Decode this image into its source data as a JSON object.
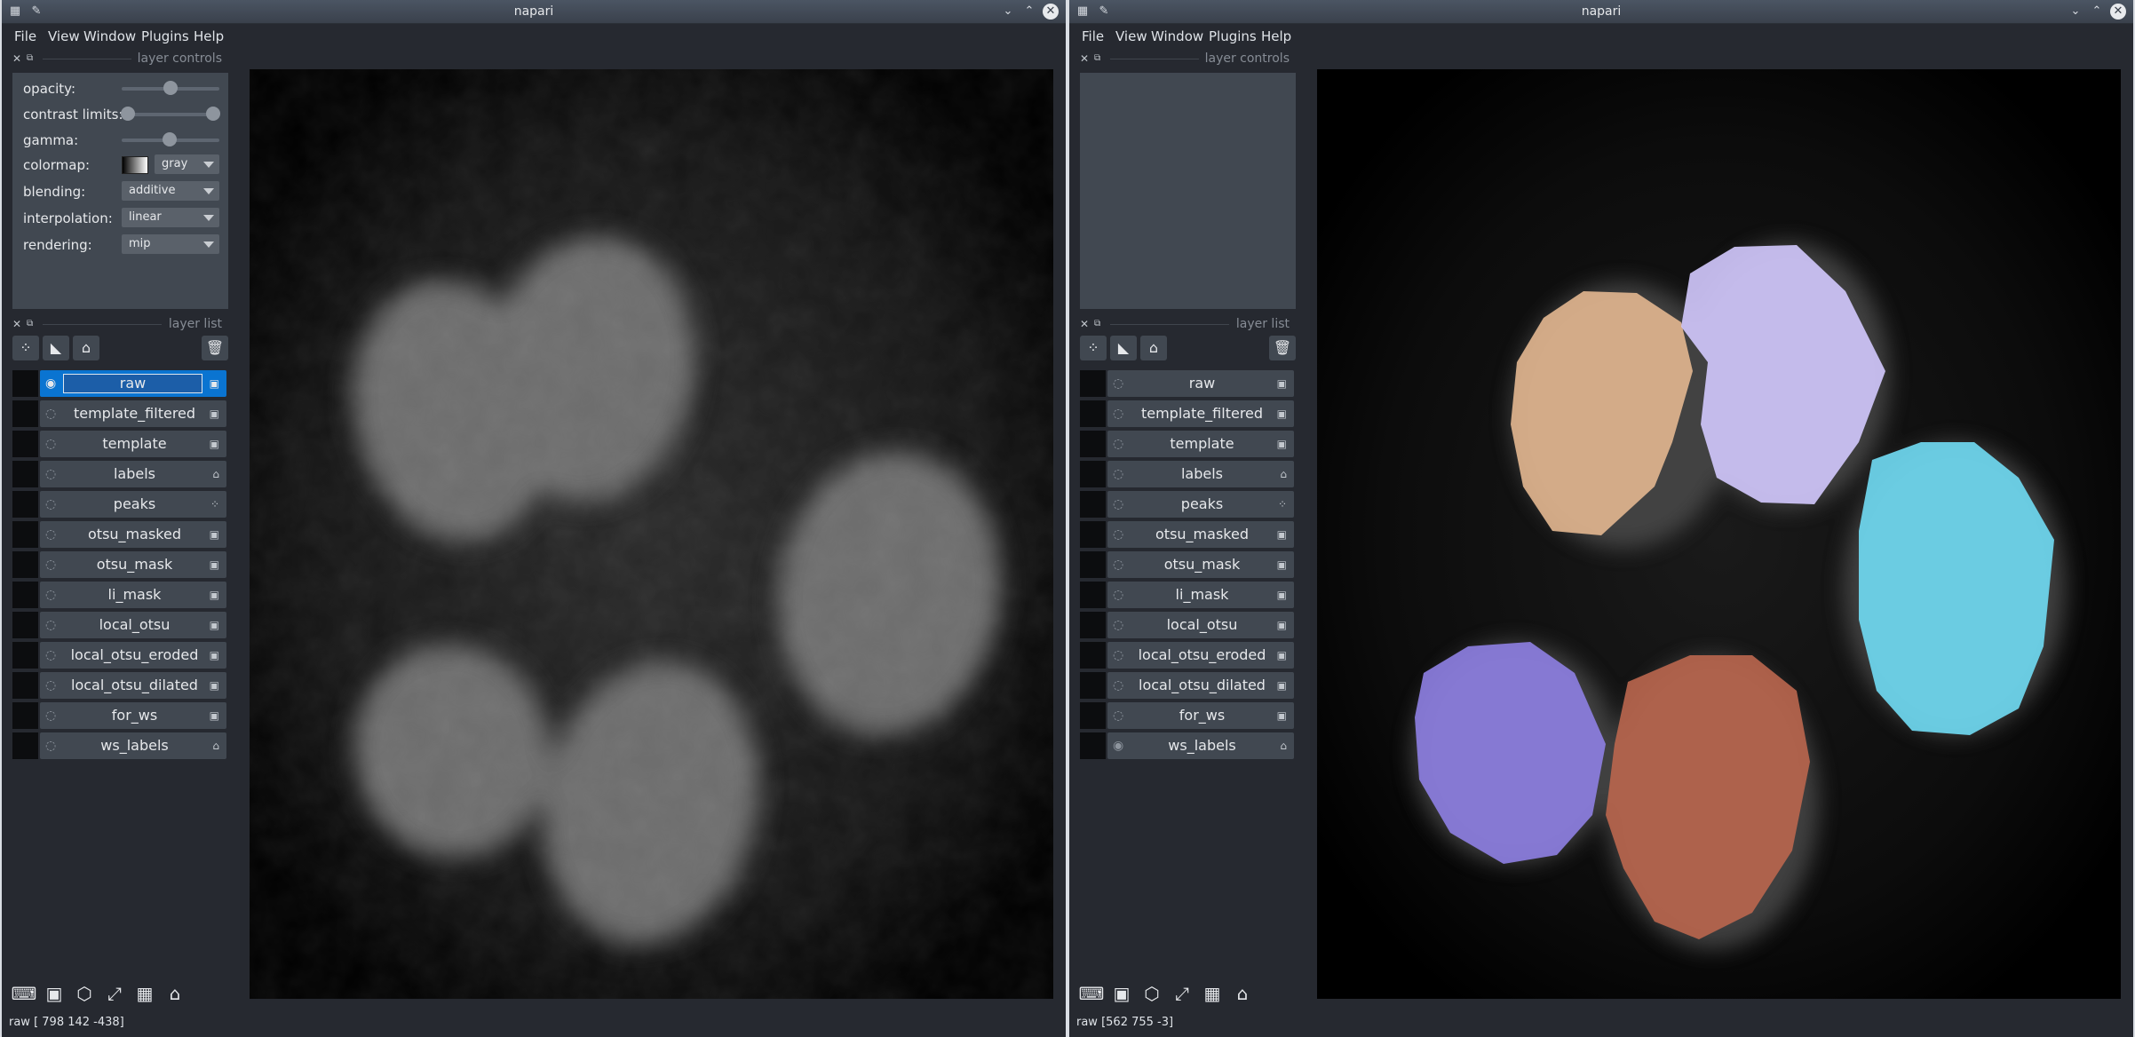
{
  "windows": [
    {
      "title": "napari",
      "menu": [
        "File",
        "View",
        "Window",
        "Plugins",
        "Help"
      ],
      "dock_controls_title": "layer controls",
      "dock_list_title": "layer list",
      "controls": {
        "opacity_label": "opacity:",
        "opacity_value": 0.5,
        "contrast_label": "contrast limits:",
        "contrast_range": [
          0.0,
          1.0
        ],
        "gamma_label": "gamma:",
        "gamma_value": 0.5,
        "colormap_label": "colormap:",
        "colormap_value": "gray",
        "blending_label": "blending:",
        "blending_value": "additive",
        "interpolation_label": "interpolation:",
        "interpolation_value": "linear",
        "rendering_label": "rendering:",
        "rendering_value": "mip"
      },
      "layers": [
        {
          "name": "raw",
          "type": "image",
          "visible": true,
          "selected": true
        },
        {
          "name": "template_filtered",
          "type": "image",
          "visible": false
        },
        {
          "name": "template",
          "type": "image",
          "visible": false
        },
        {
          "name": "labels",
          "type": "labels",
          "visible": false
        },
        {
          "name": "peaks",
          "type": "points",
          "visible": false
        },
        {
          "name": "otsu_masked",
          "type": "image",
          "visible": false
        },
        {
          "name": "otsu_mask",
          "type": "image",
          "visible": false
        },
        {
          "name": "li_mask",
          "type": "image",
          "visible": false
        },
        {
          "name": "local_otsu",
          "type": "image",
          "visible": false
        },
        {
          "name": "local_otsu_eroded",
          "type": "image",
          "visible": false
        },
        {
          "name": "local_otsu_dilated",
          "type": "image",
          "visible": false
        },
        {
          "name": "for_ws",
          "type": "image",
          "visible": false
        },
        {
          "name": "ws_labels",
          "type": "labels",
          "visible": false
        }
      ],
      "status": "raw [ 798  142 -438]"
    },
    {
      "title": "napari",
      "menu": [
        "File",
        "View",
        "Window",
        "Plugins",
        "Help"
      ],
      "dock_controls_title": "layer controls",
      "dock_list_title": "layer list",
      "layers": [
        {
          "name": "raw",
          "type": "image",
          "visible": false
        },
        {
          "name": "template_filtered",
          "type": "image",
          "visible": false
        },
        {
          "name": "template",
          "type": "image",
          "visible": false
        },
        {
          "name": "labels",
          "type": "labels",
          "visible": false
        },
        {
          "name": "peaks",
          "type": "points",
          "visible": false
        },
        {
          "name": "otsu_masked",
          "type": "image",
          "visible": false
        },
        {
          "name": "otsu_mask",
          "type": "image",
          "visible": false
        },
        {
          "name": "li_mask",
          "type": "image",
          "visible": false
        },
        {
          "name": "local_otsu",
          "type": "image",
          "visible": false
        },
        {
          "name": "local_otsu_eroded",
          "type": "image",
          "visible": false
        },
        {
          "name": "local_otsu_dilated",
          "type": "image",
          "visible": false
        },
        {
          "name": "for_ws",
          "type": "image",
          "visible": false
        },
        {
          "name": "ws_labels",
          "type": "labels",
          "visible": true
        }
      ],
      "status": "raw [562 755  -3]",
      "label_colors": [
        "#e0b48e",
        "#cfc6fa",
        "#6fd8f0",
        "#8c7ee0",
        "#b7654d"
      ]
    }
  ],
  "icons": {
    "close": "close-icon",
    "float": "float-icon",
    "eye": "eye-icon",
    "image_type": "image-type-icon",
    "labels_type": "labels-type-icon",
    "points_type": "points-type-icon"
  }
}
